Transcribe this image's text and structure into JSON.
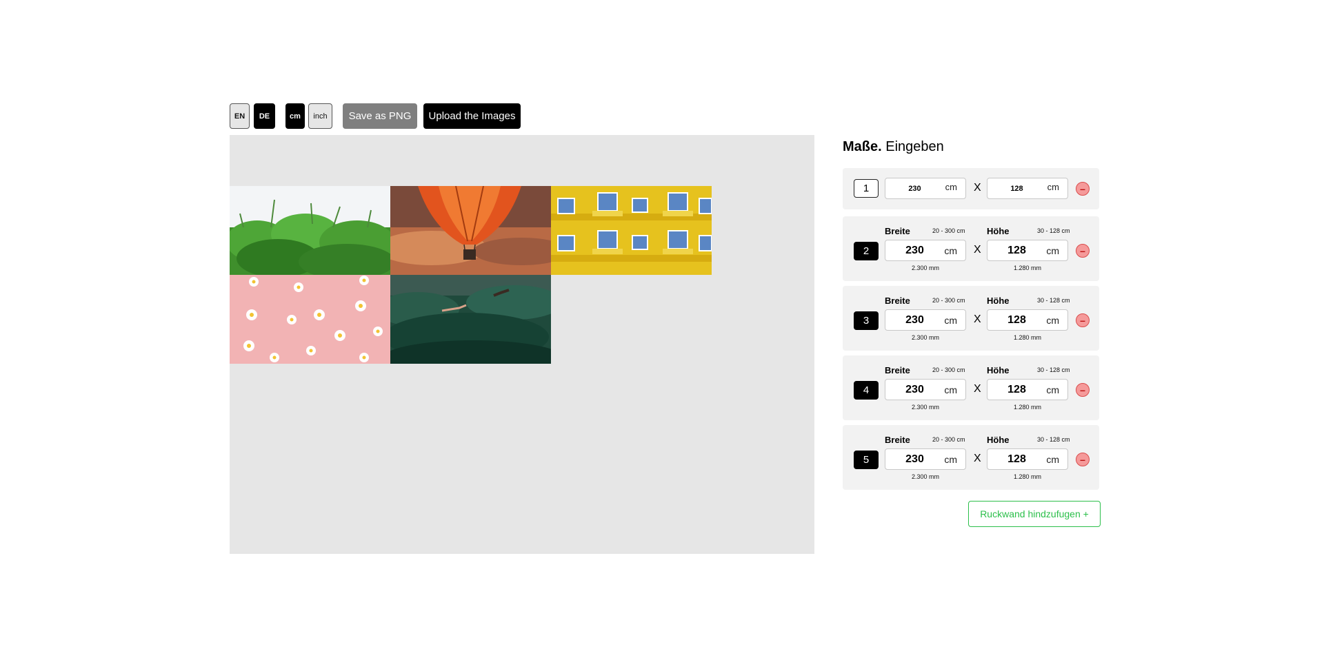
{
  "toolbar": {
    "lang_en": "EN",
    "lang_de": "DE",
    "unit_cm": "cm",
    "unit_inch": "inch",
    "save_png": "Save as PNG",
    "upload": "Upload the Images"
  },
  "panel": {
    "title_bold": "Maße.",
    "title_rest": " Eingeben"
  },
  "rows": [
    {
      "index": "1",
      "width": "230",
      "height": "128",
      "unit": "cm",
      "sep": "X"
    },
    {
      "index": "2",
      "width_label": "Breite",
      "width_range": "20 - 300 cm",
      "width": "230",
      "width_mm": "2.300 mm",
      "height_label": "Höhe",
      "height_range": "30 - 128 cm",
      "height": "128",
      "height_mm": "1.280 mm",
      "unit": "cm",
      "sep": "X"
    },
    {
      "index": "3",
      "width_label": "Breite",
      "width_range": "20 - 300 cm",
      "width": "230",
      "width_mm": "2.300 mm",
      "height_label": "Höhe",
      "height_range": "30 - 128 cm",
      "height": "128",
      "height_mm": "1.280 mm",
      "unit": "cm",
      "sep": "X"
    },
    {
      "index": "4",
      "width_label": "Breite",
      "width_range": "20 - 300 cm",
      "width": "230",
      "width_mm": "2.300 mm",
      "height_label": "Höhe",
      "height_range": "30 - 128 cm",
      "height": "128",
      "height_mm": "1.280 mm",
      "unit": "cm",
      "sep": "X"
    },
    {
      "index": "5",
      "width_label": "Breite",
      "width_range": "20 - 300 cm",
      "width": "230",
      "width_mm": "2.300 mm",
      "height_label": "Höhe",
      "height_range": "30 - 128 cm",
      "height": "128",
      "height_mm": "1.280 mm",
      "unit": "cm",
      "sep": "X"
    }
  ],
  "remove_symbol": "–",
  "add_button": "Ruckwand hindzufugen +",
  "images": [
    "plants-photo",
    "hot-air-balloon-photo",
    "yellow-building-photo",
    "daisies-on-pink-photo",
    "forest-photo"
  ],
  "colors": {
    "accent_green": "#2bbf4a",
    "remove_red": "#f59a9a",
    "canvas_grey": "#e6e6e6"
  }
}
